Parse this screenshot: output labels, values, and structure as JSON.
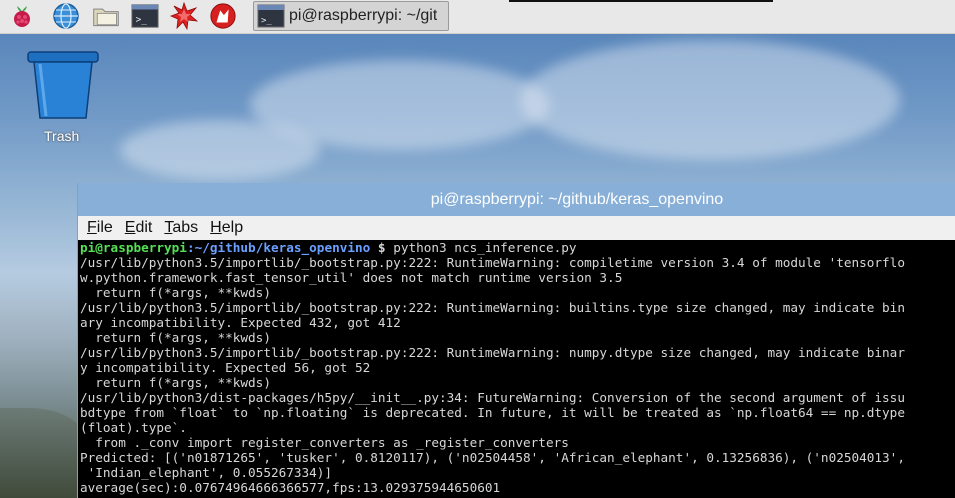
{
  "taskbar": {
    "icons": [
      "raspberry-menu-icon",
      "web-browser-icon",
      "file-manager-icon",
      "terminal-icon",
      "mathematica-icon",
      "wolfram-icon"
    ],
    "active_task": {
      "icon": "terminal-icon",
      "label": "pi@raspberrypi: ~/git"
    }
  },
  "desktop": {
    "trash_label": "Trash"
  },
  "window": {
    "title": "pi@raspberrypi: ~/github/keras_openvino",
    "menu": [
      "File",
      "Edit",
      "Tabs",
      "Help"
    ]
  },
  "terminal": {
    "prompt": {
      "user_host": "pi@raspberrypi",
      "path": ":~/github/keras_openvino",
      "symbol": " $ ",
      "command": "python3 ncs_inference.py"
    },
    "output": [
      "/usr/lib/python3.5/importlib/_bootstrap.py:222: RuntimeWarning: compiletime version 3.4 of module 'tensorflo",
      "w.python.framework.fast_tensor_util' does not match runtime version 3.5",
      "  return f(*args, **kwds)",
      "/usr/lib/python3.5/importlib/_bootstrap.py:222: RuntimeWarning: builtins.type size changed, may indicate bin",
      "ary incompatibility. Expected 432, got 412",
      "  return f(*args, **kwds)",
      "/usr/lib/python3.5/importlib/_bootstrap.py:222: RuntimeWarning: numpy.dtype size changed, may indicate binar",
      "y incompatibility. Expected 56, got 52",
      "  return f(*args, **kwds)",
      "/usr/lib/python3/dist-packages/h5py/__init__.py:34: FutureWarning: Conversion of the second argument of issu",
      "bdtype from `float` to `np.floating` is deprecated. In future, it will be treated as `np.float64 == np.dtype",
      "(float).type`.",
      "  from ._conv import register_converters as _register_converters",
      "Predicted: [('n01871265', 'tusker', 0.8120117), ('n02504458', 'African_elephant', 0.13256836), ('n02504013',",
      " 'Indian_elephant', 0.055267334)]",
      "average(sec):0.07674964666366577,fps:13.029375944650601"
    ]
  },
  "colors": {
    "taskbar_bg": "#e8e8e8",
    "title_bar": "#87afd7",
    "terminal_bg": "#000000",
    "prompt_user": "#55e055",
    "prompt_path": "#6aa0ff"
  }
}
